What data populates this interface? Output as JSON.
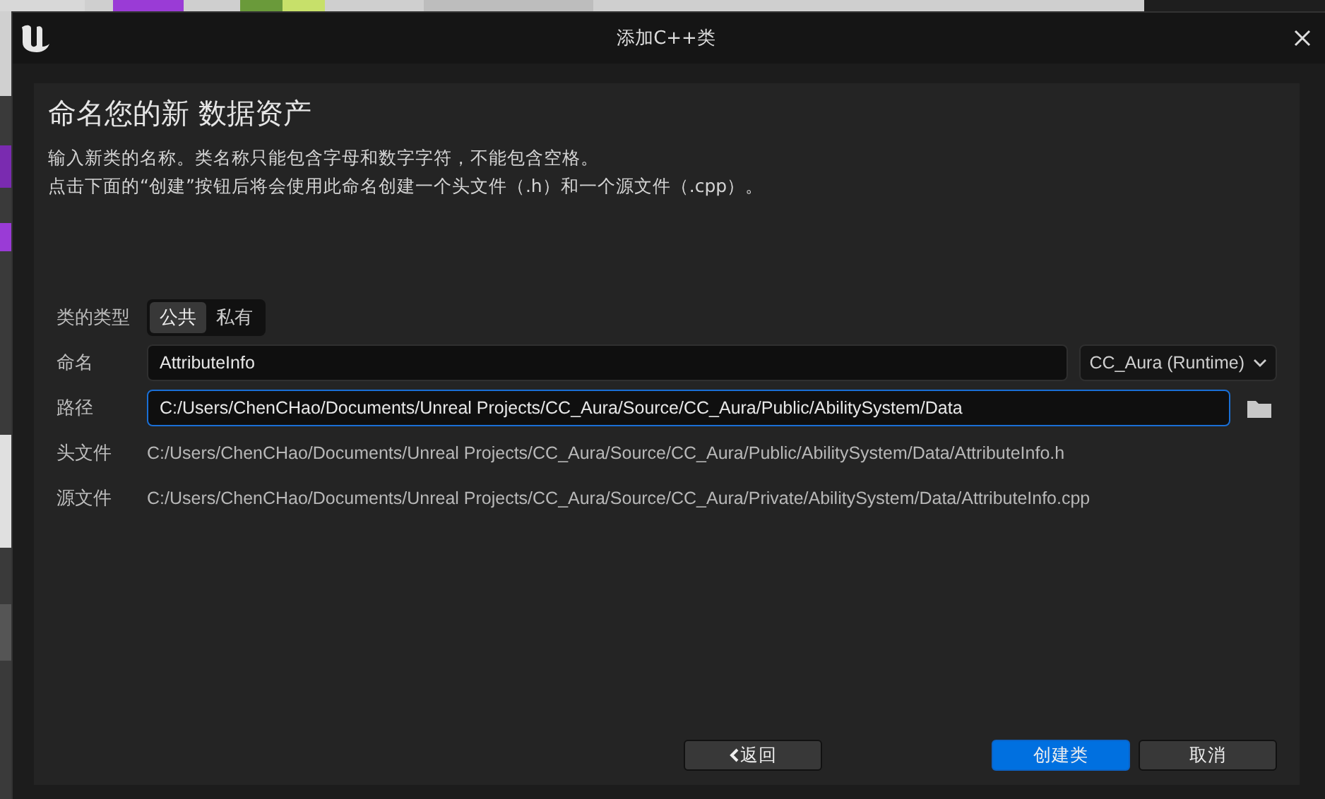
{
  "window": {
    "title": "添加C++类"
  },
  "heading": "命名您的新 数据资产",
  "description": [
    "输入新类的名称。类名称只能包含字母和数字字符，不能包含空格。",
    "点击下面的“创建”按钮后将会使用此命名创建一个头文件（.h）和一个源文件（.cpp）。"
  ],
  "class_type": {
    "label": "类的类型",
    "options": [
      {
        "label": "公共",
        "selected": true
      },
      {
        "label": "私有",
        "selected": false
      }
    ]
  },
  "name": {
    "label": "命名",
    "value": "AttributeInfo",
    "module": "CC_Aura (Runtime)"
  },
  "path": {
    "label": "路径",
    "value": "C:/Users/ChenCHao/Documents/Unreal Projects/CC_Aura/Source/CC_Aura/Public/AbilitySystem/Data",
    "focused": true
  },
  "header_file": {
    "label": "头文件",
    "value": "C:/Users/ChenCHao/Documents/Unreal Projects/CC_Aura/Source/CC_Aura/Public/AbilitySystem/Data/AttributeInfo.h"
  },
  "source_file": {
    "label": "源文件",
    "value": "C:/Users/ChenCHao/Documents/Unreal Projects/CC_Aura/Source/CC_Aura/Private/AbilitySystem/Data/AttributeInfo.cpp"
  },
  "buttons": [
    {
      "label": "返回",
      "kind": "back"
    },
    {
      "label": "创建类",
      "kind": "primary"
    },
    {
      "label": "取消",
      "kind": "normal"
    }
  ]
}
